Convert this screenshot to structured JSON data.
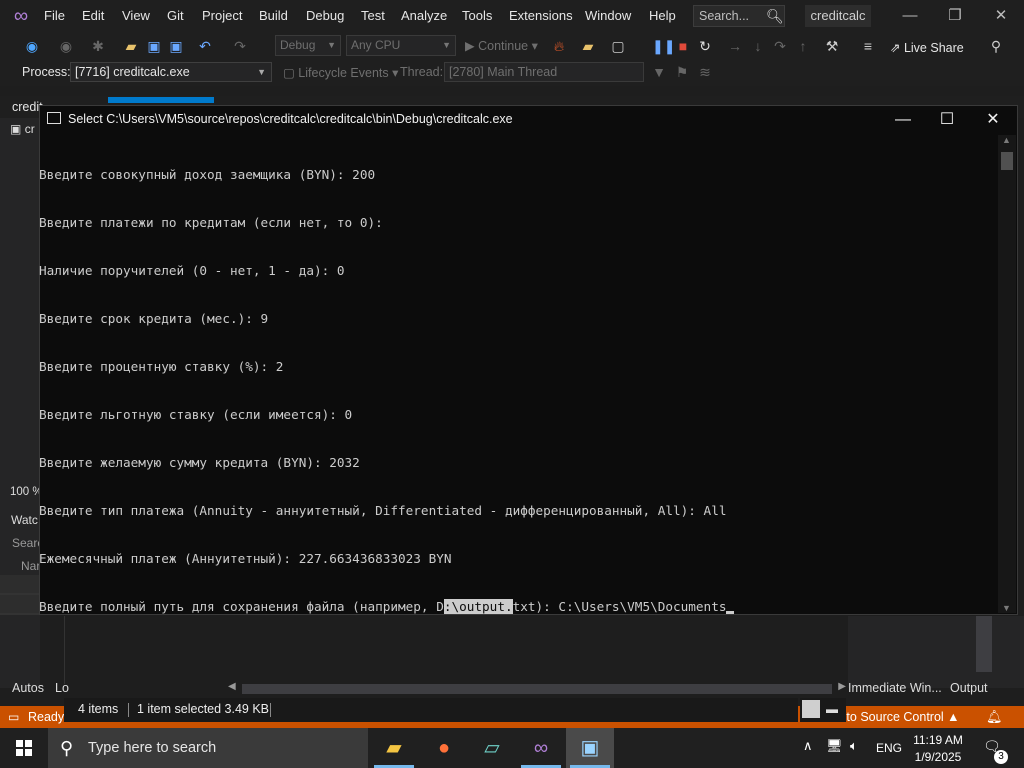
{
  "menubar": {
    "items": [
      "File",
      "Edit",
      "View",
      "Git",
      "Project",
      "Build",
      "Debug",
      "Test",
      "Analyze",
      "Tools",
      "Extensions",
      "Window",
      "Help"
    ],
    "search_placeholder": "Search...",
    "solution_name": "creditcalc"
  },
  "toolbar1": {
    "config": "Debug",
    "platform": "Any CPU",
    "continue_label": "Continue",
    "live_share": "Live Share"
  },
  "toolbar2": {
    "process_label": "Process:",
    "process_value": "[7716] creditcalc.exe",
    "lifecycle_label": "Lifecycle Events",
    "thread_label": "Thread:",
    "thread_value": "[2780] Main Thread"
  },
  "ide": {
    "doc_tab": "credit",
    "left_item": "cr",
    "zoom": "100 %",
    "watch": "Watc",
    "search": "Searc",
    "name": "Nar",
    "autos_tab": "Autos",
    "locals_tab": "Lo",
    "immediate_tab": "Immediate Win...",
    "output_tab": "Output"
  },
  "status": {
    "ready": "Ready",
    "source_control": "d to Source Control",
    "items_count": "4 items",
    "selected_info": "1 item selected  3.49 KB"
  },
  "console": {
    "title": "Select C:\\Users\\VM5\\source\\repos\\creditcalc\\creditcalc\\bin\\Debug\\creditcalc.exe",
    "lines": [
      "Введите совокупный доход заемщика (BYN): 200",
      "Введите платежи по кредитам (если нет, то 0):",
      "Наличие поручителей (0 - нет, 1 - да): 0",
      "Введите срок кредита (мес.): 9",
      "Введите процентную ставку (%): 2",
      "Введите льготную ставку (если имеется): 0",
      "Введите желаемую сумму кредита (BYN): 2032",
      "Введите тип платежа (Annuity - аннуитетный, Differentiated - дифференцированный, All): All",
      "Ежемесячный платеж (Аннуитетный): 227.663436833023 BYN"
    ],
    "last_line_pre": "Введите полный путь для сохранения файла (например, D",
    "last_line_sel": ":\\output.",
    "last_line_post": "txt): C:\\Users\\VM5\\Documents"
  },
  "taskbar": {
    "search_placeholder": "Type here to search",
    "lang": "ENG",
    "time": "11:19 AM",
    "date": "1/9/2025",
    "notifications": "3"
  },
  "colors": {
    "status_bar": "#ca5100",
    "accent": "#007acc"
  }
}
